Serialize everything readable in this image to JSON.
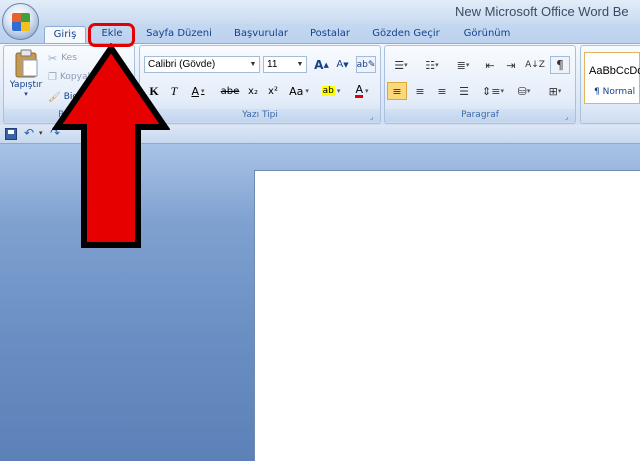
{
  "window": {
    "title": "New Microsoft Office Word Be"
  },
  "tabs": [
    "Giriş",
    "Ekle",
    "Sayfa Düzeni",
    "Başvurular",
    "Postalar",
    "Gözden Geçir",
    "Görünüm"
  ],
  "clipboard": {
    "paste_label": "Yapıştır",
    "cut_label": "Kes",
    "copy_label": "Kopyala",
    "format_painter_label": "Biçim",
    "group_label": "Pano"
  },
  "font": {
    "font_name": "Calibri (Gövde)",
    "font_size": "11",
    "bold": "K",
    "italic": "T",
    "underline": "A",
    "strike": "abe",
    "subscript": "x₂",
    "superscript": "x²",
    "change_case": "Aa",
    "grow": "A",
    "shrink": "A",
    "group_label": "Yazı Tipi"
  },
  "paragraph": {
    "group_label": "Paragraf"
  },
  "styles": {
    "preview": "AaBbCcDd",
    "normal_label": "¶ Normal"
  },
  "colors": {
    "accent_red": "#e30000",
    "highlight_yellow": "#ffff00",
    "font_red": "#e30000"
  }
}
